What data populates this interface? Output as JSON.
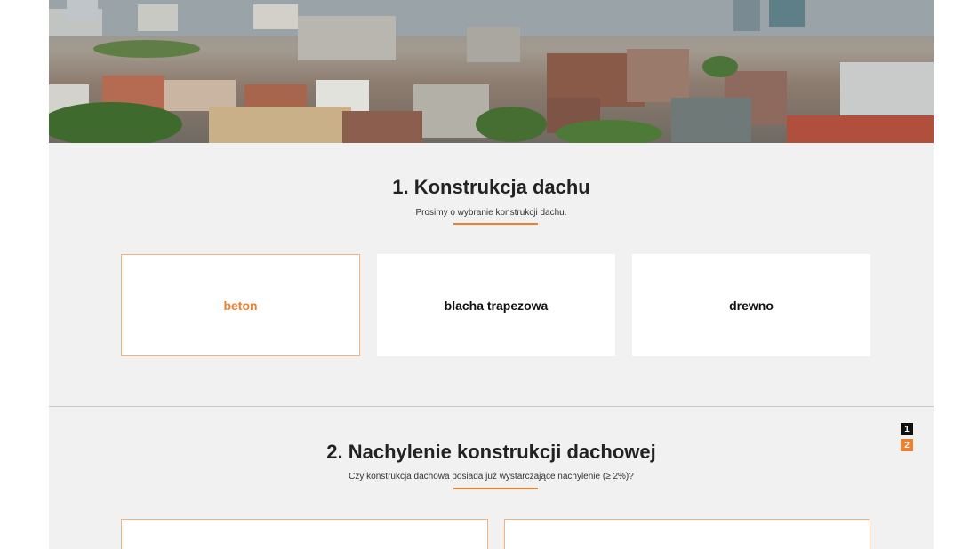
{
  "colors": {
    "accent": "#ee7f2d",
    "background": "#f1f1f1",
    "card": "#ffffff"
  },
  "hero": {
    "icon": "city-skyline-photo"
  },
  "section1": {
    "title": "1. Konstrukcja dachu",
    "subtitle": "Prosimy o wybranie konstrukcji dachu.",
    "options": [
      {
        "label": "beton",
        "selected": true
      },
      {
        "label": "blacha trapezowa",
        "selected": false
      },
      {
        "label": "drewno",
        "selected": false
      }
    ]
  },
  "section2": {
    "title": "2. Nachylenie konstrukcji dachowej",
    "subtitle": "Czy konstrukcja dachowa posiada już wystarczające nachylenie (≥ 2%)?"
  },
  "pager": {
    "pages": [
      "1",
      "2"
    ]
  }
}
